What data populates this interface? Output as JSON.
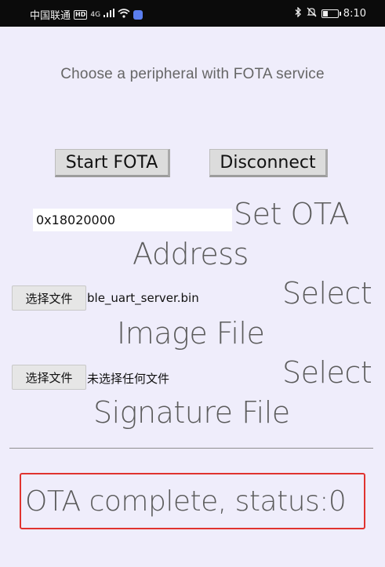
{
  "status_bar": {
    "carrier": "中国联通",
    "hd_badge": "HD",
    "network": "4G",
    "time": "8:10",
    "icons": [
      "signal-icon",
      "wifi-icon",
      "app-notification-icon",
      "bluetooth-icon",
      "mute-icon",
      "battery-icon"
    ]
  },
  "header": {
    "title": "Choose a peripheral with FOTA service"
  },
  "actions": {
    "start_label": "Start FOTA",
    "disconnect_label": "Disconnect"
  },
  "ota_address": {
    "value": "0x18020000",
    "label_line1": "Set OTA",
    "label_line2": "Address"
  },
  "image_file": {
    "button_label": "选择文件",
    "file_name": "ble_uart_server.bin",
    "label_line1": "Select",
    "label_line2": "Image File"
  },
  "signature_file": {
    "button_label": "选择文件",
    "file_name": "未选择任何文件",
    "label_line1": "Select",
    "label_line2": "Signature File"
  },
  "status": {
    "message": "OTA complete, status:0",
    "highlight_color": "#e0332f"
  }
}
